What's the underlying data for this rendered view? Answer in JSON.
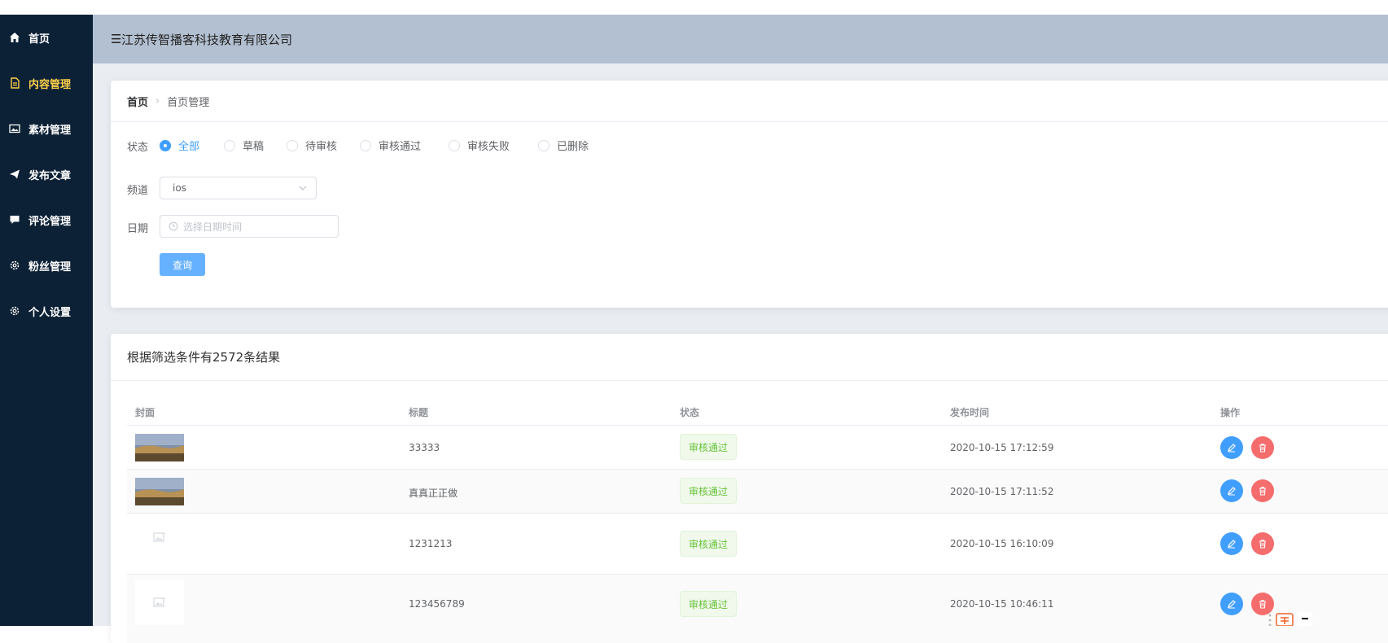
{
  "app": {
    "company": "江苏传智播客科技教育有限公司"
  },
  "sidebar": {
    "items": [
      {
        "label": "首页",
        "icon": "home-icon",
        "active": false
      },
      {
        "label": "内容管理",
        "icon": "document-icon",
        "active": true
      },
      {
        "label": "素材管理",
        "icon": "image-icon",
        "active": false
      },
      {
        "label": "发布文章",
        "icon": "send-icon",
        "active": false
      },
      {
        "label": "评论管理",
        "icon": "comment-icon",
        "active": false
      },
      {
        "label": "粉丝管理",
        "icon": "gear-icon",
        "active": false
      },
      {
        "label": "个人设置",
        "icon": "gear-icon",
        "active": false
      }
    ]
  },
  "breadcrumb": {
    "home": "首页",
    "current": "首页管理"
  },
  "filter": {
    "status_label": "状态",
    "status_options": [
      "全部",
      "草稿",
      "待审核",
      "审核通过",
      "审核失败",
      "已删除"
    ],
    "status_selected": "全部",
    "channel_label": "频道",
    "channel_value": "ios",
    "date_label": "日期",
    "date_placeholder": "选择日期时间",
    "query_button": "查询"
  },
  "results": {
    "summary": "根据筛选条件有2572条结果",
    "columns": [
      "封面",
      "标题",
      "状态",
      "发布时间",
      "操作"
    ],
    "rows": [
      {
        "cover": "landscape-photo",
        "title": "33333",
        "status": "审核通过",
        "time": "2020-10-15 17:12:59"
      },
      {
        "cover": "landscape-photo",
        "title": "真真正正做",
        "status": "审核通过",
        "time": "2020-10-15 17:11:52"
      },
      {
        "cover": "image-placeholder-icon",
        "title": "1231213",
        "status": "审核通过",
        "time": "2020-10-15 16:10:09"
      },
      {
        "cover": "image-placeholder-icon",
        "title": "123456789",
        "status": "审核通过",
        "time": "2020-10-15 10:46:11"
      }
    ]
  },
  "colors": {
    "sidebar_bg": "#0c2135",
    "active_nav": "#ffd04b",
    "header_bg": "#b3c0d1",
    "primary": "#409eff",
    "danger": "#f56c6c",
    "success": "#67c23a"
  }
}
